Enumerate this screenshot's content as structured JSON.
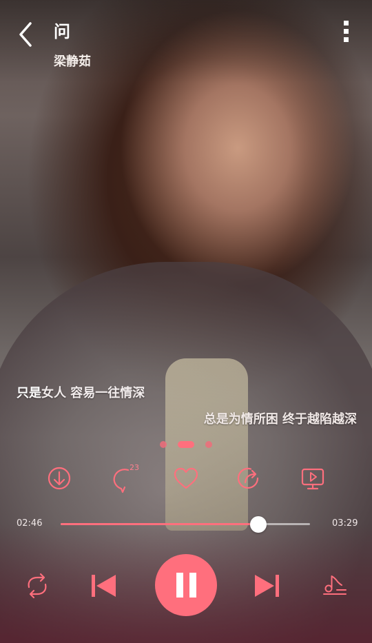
{
  "header": {
    "song_title": "问",
    "artist": "梁静茹"
  },
  "lyrics": {
    "current_highlight": "只是",
    "current_rest": "女人 容易一往情深",
    "next_line": "总是为情所困 终于越陷越深"
  },
  "pager": {
    "pages": 3,
    "active_index": 1
  },
  "actions": {
    "comment_count": "23",
    "items": [
      "download-icon",
      "comment-icon",
      "heart-icon",
      "share-icon",
      "video-icon"
    ]
  },
  "progress": {
    "elapsed": "02:46",
    "total": "03:29",
    "fraction": 0.794
  },
  "controls": {
    "items": [
      "repeat-icon",
      "previous-icon",
      "pause-icon",
      "next-icon",
      "playlist-icon"
    ]
  },
  "colors": {
    "accent": "#ff6f7d",
    "text": "#ffffff"
  }
}
